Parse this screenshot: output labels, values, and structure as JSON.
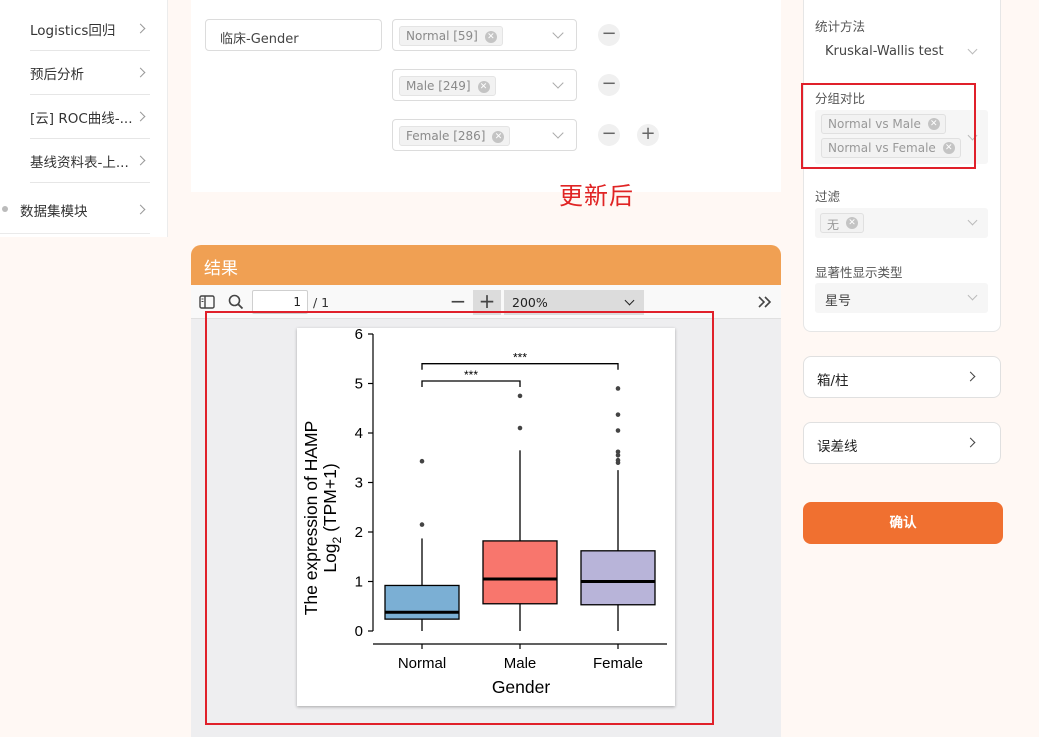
{
  "sidebar": {
    "items": [
      {
        "label": "Logistics回归"
      },
      {
        "label": "预后分析"
      },
      {
        "label": "[云] ROC曲线-..."
      },
      {
        "label": "基线资料表-上..."
      },
      {
        "label": "数据集模块"
      }
    ]
  },
  "config": {
    "variable_value": "临床-Gender",
    "groups": [
      {
        "tag": "Normal [59]"
      },
      {
        "tag": "Male [249]"
      },
      {
        "tag": "Female [286]"
      }
    ],
    "minus_symbol": "−",
    "plus_symbol": "+"
  },
  "annotation": {
    "text": "更新后",
    "color": "#e02424"
  },
  "results": {
    "header_title": "结果",
    "viewer": {
      "page_current": "1",
      "page_total": "/ 1",
      "zoom": "200%",
      "zoom_out": "−",
      "zoom_in": "+"
    }
  },
  "right_panel": {
    "stat_method_label": "统计方法",
    "stat_method_value": "Kruskal-Wallis test",
    "comparison_label": "分组对比",
    "comparisons": [
      "Normal vs Male",
      "Normal vs Female"
    ],
    "filter_label": "过滤",
    "filter_value": "无",
    "sig_type_label": "显著性显示类型",
    "sig_type_value": "星号",
    "accordion_box": "箱/柱",
    "accordion_error": "误差线",
    "confirm_label": "确认"
  },
  "colors": {
    "accent_orange": "#f07030",
    "header_orange": "#f0a053",
    "highlight_red": "#e0202a"
  },
  "chart_data": {
    "type": "box",
    "categories": [
      "Normal",
      "Male",
      "Female"
    ],
    "xlabel": "Gender",
    "ylabel_line1": "The expression of HAMP",
    "ylabel_line2_main": "Log",
    "ylabel_line2_sub": "2",
    "ylabel_line2_rest": " (TPM+1)",
    "ylim": [
      0,
      6
    ],
    "yticks": [
      0,
      1,
      2,
      3,
      4,
      5,
      6
    ],
    "series": [
      {
        "category": "Normal",
        "color": "#7bafd4",
        "q1": 0.24,
        "median": 0.38,
        "q3": 0.92,
        "whisker_low": 0,
        "whisker_high": 1.87,
        "outliers": [
          2.15,
          3.43
        ]
      },
      {
        "category": "Male",
        "color": "#f8766d",
        "q1": 0.55,
        "median": 1.05,
        "q3": 1.82,
        "whisker_low": 0,
        "whisker_high": 3.65,
        "outliers": [
          4.1,
          4.75
        ]
      },
      {
        "category": "Female",
        "color": "#b8b4d9",
        "q1": 0.53,
        "median": 1.0,
        "q3": 1.62,
        "whisker_low": 0,
        "whisker_high": 3.25,
        "outliers": [
          3.4,
          3.45,
          3.55,
          3.62,
          4.05,
          4.37,
          4.9
        ]
      }
    ],
    "significance": [
      {
        "from": "Normal",
        "to": "Male",
        "y": 5.05,
        "label": "***"
      },
      {
        "from": "Normal",
        "to": "Female",
        "y": 5.4,
        "label": "***"
      }
    ]
  }
}
